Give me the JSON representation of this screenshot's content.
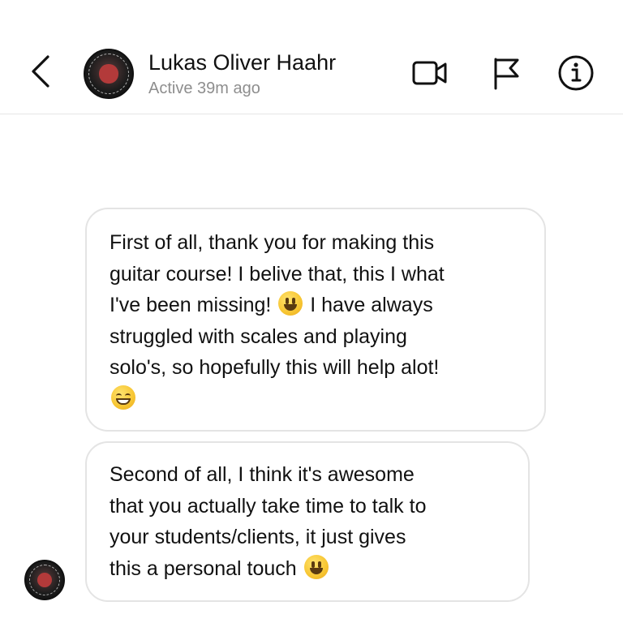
{
  "header": {
    "contact_name": "Lukas Oliver Haahr",
    "status": "Active 39m ago",
    "icons": [
      "chevron-left-icon",
      "video-camera-icon",
      "flag-icon",
      "info-icon"
    ]
  },
  "messages": [
    {
      "lines": [
        "First of all, thank you for making this",
        "guitar course! I belive that, this I what",
        "I've been missing!",
        " I have always",
        "struggled with scales and playing",
        "solo's, so hopefully this will help alot!"
      ],
      "emojis": [
        "smiling-face-emoji",
        "grinning-face-emoji"
      ]
    },
    {
      "lines": [
        "Second of all, I think it's awesome",
        "that you actually take time to talk to",
        "your students/clients, it just gives",
        "this a personal touch"
      ],
      "emojis": [
        "smiling-face-emoji"
      ]
    }
  ]
}
